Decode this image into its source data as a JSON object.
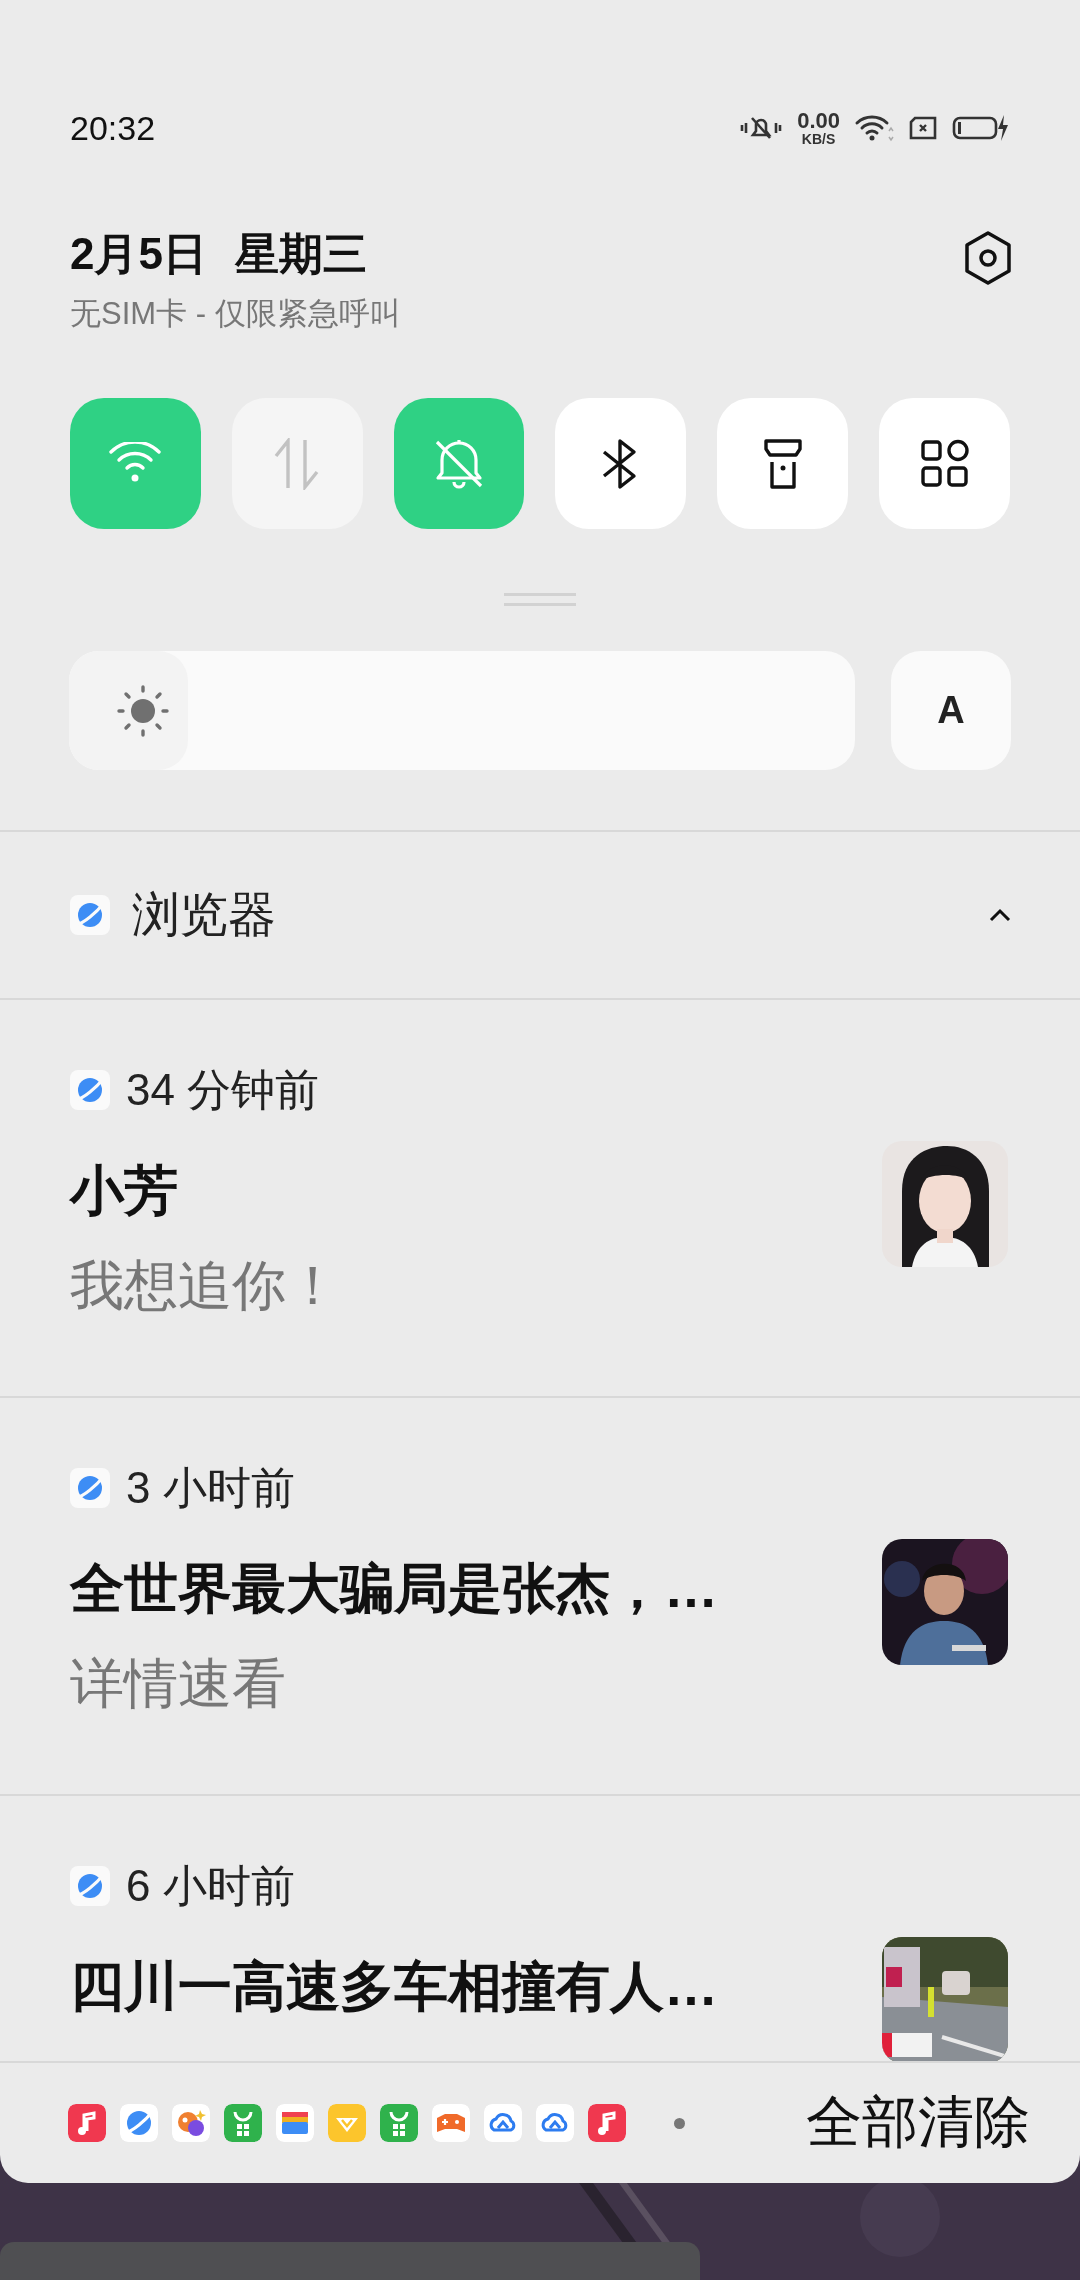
{
  "status_bar": {
    "time": "20:32",
    "net_speed": "0.00",
    "net_unit": "KB/S"
  },
  "header": {
    "date": "2月5日",
    "weekday": "星期三",
    "sim_status": "无SIM卡 - 仅限紧急呼叫"
  },
  "toggles": [
    {
      "kind": "wifi",
      "on": true,
      "disabled": false
    },
    {
      "kind": "data",
      "on": false,
      "disabled": true
    },
    {
      "kind": "mute",
      "on": true,
      "disabled": false
    },
    {
      "kind": "bluetooth",
      "on": false,
      "disabled": false
    },
    {
      "kind": "flashlight",
      "on": false,
      "disabled": false
    },
    {
      "kind": "apps",
      "on": false,
      "disabled": false
    }
  ],
  "brightness": {
    "level": 0,
    "auto_label": "A"
  },
  "group": {
    "app": "浏览器",
    "expanded": true
  },
  "notifications": [
    {
      "time": "34 分钟前",
      "title": "小芳",
      "body": "我想追你！"
    },
    {
      "time": "3 小时前",
      "title": "全世界最大骗局是张杰，…",
      "body": "详情速看"
    },
    {
      "time": "6 小时前",
      "title": "四川一高速多车相撞有人…"
    }
  ],
  "dock_icons": [
    {
      "kind": "music"
    },
    {
      "kind": "browser"
    },
    {
      "kind": "paint"
    },
    {
      "kind": "store"
    },
    {
      "kind": "wallet"
    },
    {
      "kind": "diamond"
    },
    {
      "kind": "store"
    },
    {
      "kind": "game"
    },
    {
      "kind": "cloud"
    },
    {
      "kind": "cloud"
    },
    {
      "kind": "music"
    }
  ],
  "clear_button": "全部清除"
}
